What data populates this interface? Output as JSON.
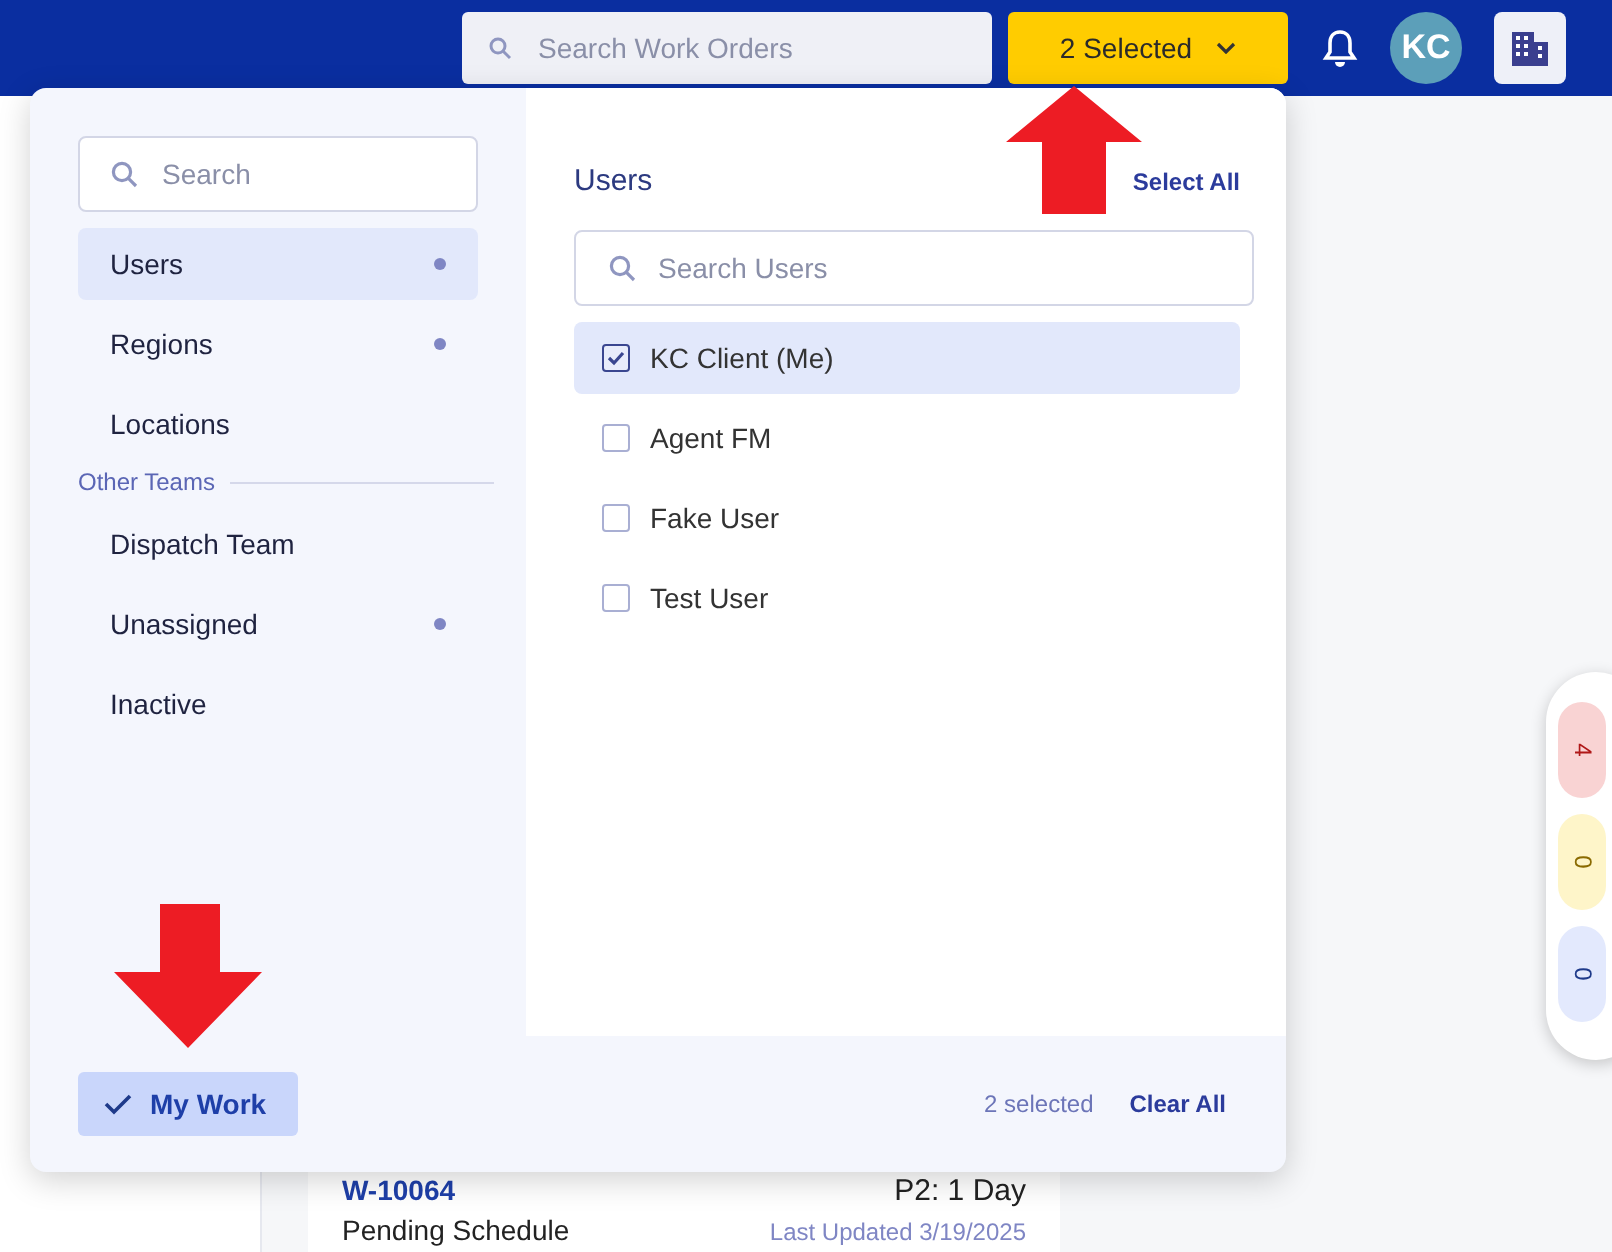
{
  "header": {
    "search": {
      "placeholder": "Search Work Orders"
    },
    "selector": {
      "label": "2 Selected"
    },
    "avatar": "KC"
  },
  "filter_panel": {
    "search": {
      "placeholder": "Search"
    },
    "nav_items": [
      {
        "label": "Users",
        "selected": true,
        "dot": true
      },
      {
        "label": "Regions",
        "selected": false,
        "dot": true
      },
      {
        "label": "Locations",
        "selected": false,
        "dot": false
      }
    ],
    "section_label": "Other Teams",
    "team_items": [
      {
        "label": "Dispatch Team",
        "selected": false,
        "dot": false
      },
      {
        "label": "Unassigned",
        "selected": false,
        "dot": true
      },
      {
        "label": "Inactive",
        "selected": false,
        "dot": false
      }
    ],
    "list_title": "Users",
    "select_all": "Select All",
    "user_search": {
      "placeholder": "Search Users"
    },
    "users": [
      {
        "name": "KC Client (Me)",
        "checked": true,
        "selected": true
      },
      {
        "name": "Agent FM",
        "checked": false,
        "selected": false
      },
      {
        "name": "Fake User",
        "checked": false,
        "selected": false
      },
      {
        "name": "Test User",
        "checked": false,
        "selected": false
      }
    ],
    "my_work": {
      "label": "My Work",
      "checked": true
    },
    "count": "2 selected",
    "clear_all": "Clear All"
  },
  "work_order": {
    "id": "W-10064",
    "priority": "P2: 1 Day",
    "status": "Pending Schedule",
    "updated": "Last Updated 3/19/2025"
  },
  "counters": [
    {
      "value": "4",
      "color": "#f9d3d3"
    },
    {
      "value": "0",
      "color": "#fef5c9"
    },
    {
      "value": "0",
      "color": "#e3e9fd"
    }
  ]
}
